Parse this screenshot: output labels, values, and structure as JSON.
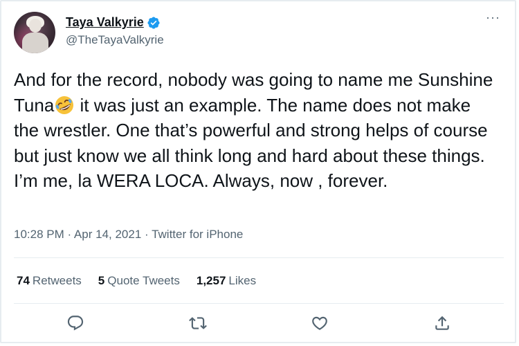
{
  "user": {
    "display_name": "Taya Valkyrie",
    "handle": "@TheTayaValkyrie",
    "verified": true
  },
  "tweet": {
    "text_part1": "And for the record, nobody was going to name me Sunshine Tuna",
    "emoji": "rolling-on-floor-laughing",
    "text_part2": " it was just an example. The name does not make the wrestler. One that’s powerful and strong helps of course but just know we all think long and hard about these things. I’m me, la WERA LOCA. Always, now , forever.",
    "meta": "10:28 PM · Apr 14, 2021 · Twitter for iPhone"
  },
  "stats": {
    "retweets_count": "74",
    "retweets_label": "Retweets",
    "quotes_count": "5",
    "quotes_label": "Quote Tweets",
    "likes_count": "1,257",
    "likes_label": "Likes"
  },
  "menu": {
    "more_label": "···"
  },
  "colors": {
    "accent": "#1d9bf0",
    "secondary_text": "#536471",
    "divider": "#e6ecf0"
  }
}
